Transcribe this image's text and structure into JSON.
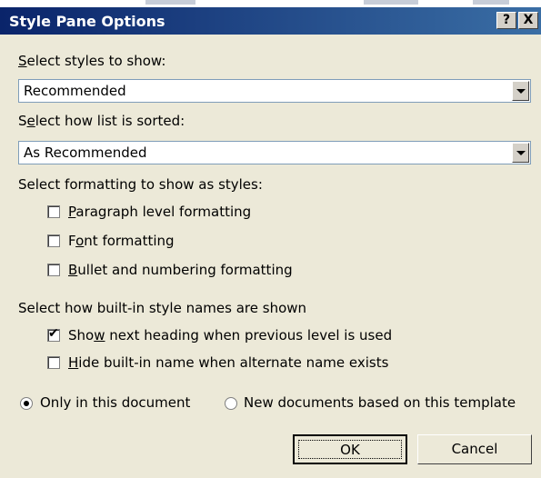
{
  "window": {
    "title": "Style Pane Options",
    "help_label": "?",
    "close_label": "X"
  },
  "styles_to_show": {
    "label": "Select styles to show:",
    "value": "Recommended"
  },
  "sort_order": {
    "label": "Select how list is sorted:",
    "value": "As Recommended"
  },
  "formatting": {
    "label": "Select formatting to show as styles:",
    "options": [
      {
        "label": "Paragraph level formatting",
        "checked": false
      },
      {
        "label": "Font formatting",
        "checked": false
      },
      {
        "label": "Bullet and numbering formatting",
        "checked": false
      }
    ]
  },
  "builtin_names": {
    "label": "Select how built-in style names are shown",
    "options": [
      {
        "label": "Show next heading when previous level is used",
        "checked": true
      },
      {
        "label": "Hide built-in name when alternate name exists",
        "checked": false
      }
    ]
  },
  "scope": {
    "options": [
      {
        "label": "Only in this document",
        "selected": true
      },
      {
        "label": "New documents based on this template",
        "selected": false
      }
    ]
  },
  "buttons": {
    "ok": "OK",
    "cancel": "Cancel"
  },
  "colors": {
    "titlebar_start": "#0a246a",
    "titlebar_end": "#3a6ea5",
    "face": "#ece9d8"
  }
}
